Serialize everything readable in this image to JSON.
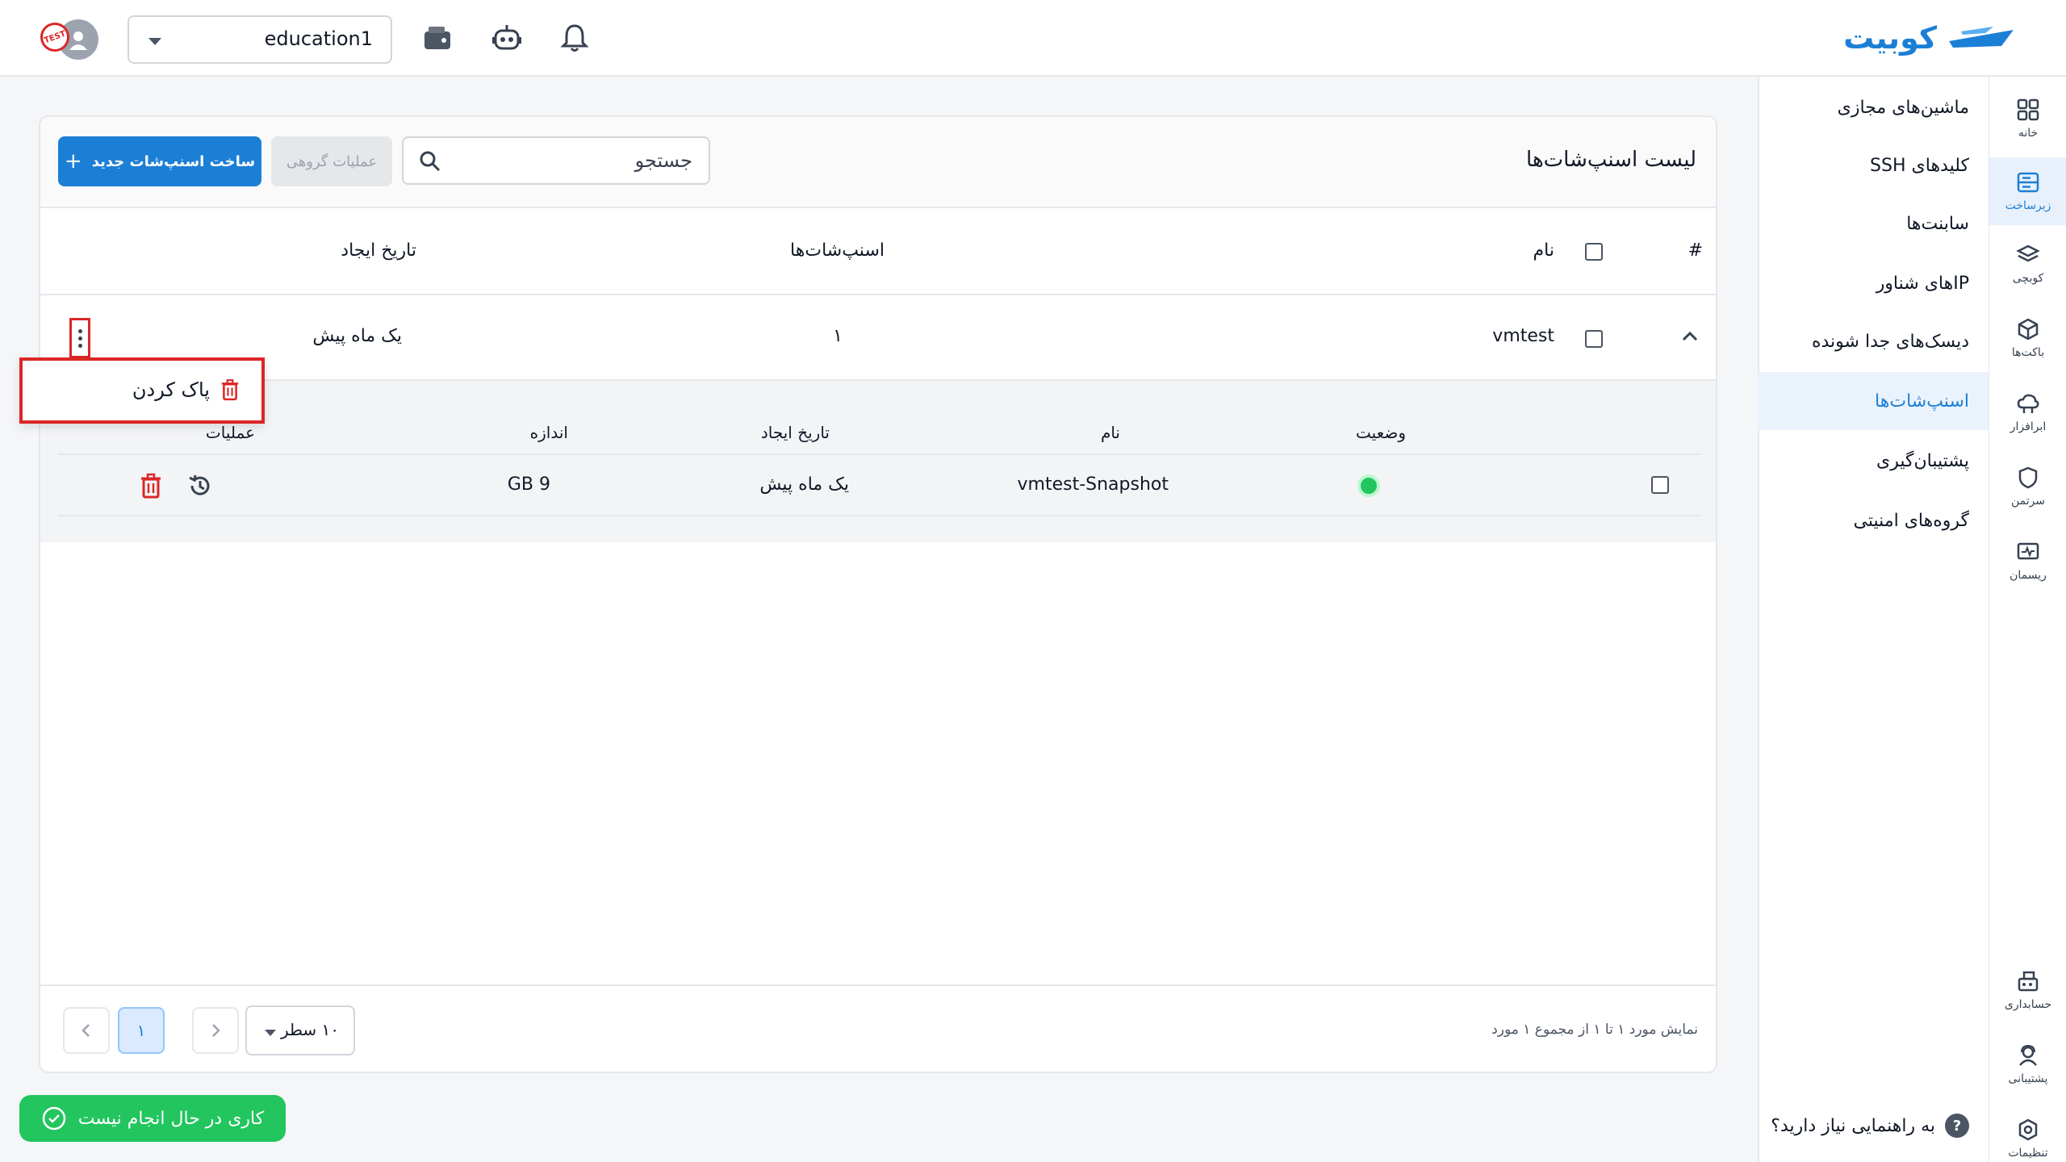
{
  "app": {
    "logo_text": "کوبیت"
  },
  "topbar": {
    "workspace_value": "education1",
    "icons": [
      "notification-bell-icon",
      "robot-icon",
      "wallet-icon"
    ],
    "avatar_badge": "TEST"
  },
  "rail": {
    "items": [
      {
        "label": "خانه",
        "icon": "home-grid-icon"
      },
      {
        "label": "زیرساخت",
        "icon": "server-icon"
      },
      {
        "label": "کوبچی",
        "icon": "layers-icon"
      },
      {
        "label": "باکت‌ها",
        "icon": "cube-icon"
      },
      {
        "label": "ابرافزار",
        "icon": "cloud-app-icon"
      },
      {
        "label": "سرتمن",
        "icon": "shield-icon"
      },
      {
        "label": "ریسمان",
        "icon": "monitor-icon"
      },
      {
        "label": "حسابداری",
        "icon": "accounting-icon"
      },
      {
        "label": "پشتیبانی",
        "icon": "support-icon"
      },
      {
        "label": "تنظیمات",
        "icon": "settings-icon"
      }
    ]
  },
  "submenu": {
    "items": [
      {
        "label": "ماشین‌های مجازی"
      },
      {
        "label": "کلیدهای SSH"
      },
      {
        "label": "سابنت‌ها"
      },
      {
        "label": "IPهای شناور"
      },
      {
        "label": "دیسک‌های جدا شونده"
      },
      {
        "label": "اسنپ‌شات‌ها"
      },
      {
        "label": "پشتیبان‌گیری"
      },
      {
        "label": "گروه‌های امنیتی"
      }
    ],
    "help_text": "به راهنمایی نیاز دارید؟",
    "help_icon_glyph": "?"
  },
  "card": {
    "title": "لیست اسنپ‌شات‌ها",
    "search_placeholder": "جستجو",
    "bulk_label": "عملیات گروهی",
    "create_label": "ساخت اسنپ‌شات جدید",
    "columns": {
      "hash": "#",
      "name": "نام",
      "snapshots": "اسنپ‌شات‌ها",
      "created": "تاریخ ایجاد"
    },
    "row": {
      "name": "vmtest",
      "snapshots": "۱",
      "created": "یک ماه پیش"
    },
    "sub_columns": {
      "status": "وضعیت",
      "name": "نام",
      "created": "تاریخ ایجاد",
      "size": "اندازه",
      "actions": "عملیات"
    },
    "sub_row": {
      "name": "vmtest-Snapshot",
      "created": "یک ماه پیش",
      "size": "9 GB",
      "status_color": "#22c55e"
    },
    "footer": {
      "info": "نمایش مورد ۱ تا ۱ از مجموع ۱ مورد",
      "rows_per_page": "۱۰ سطر",
      "current_page": "۱"
    }
  },
  "popup": {
    "delete_label": "پاک کردن"
  },
  "toast": {
    "text": "کاری در حال انجام نیست"
  },
  "colors": {
    "accent": "#1c7fd6",
    "danger": "#dc2626",
    "success": "#22c55e"
  }
}
